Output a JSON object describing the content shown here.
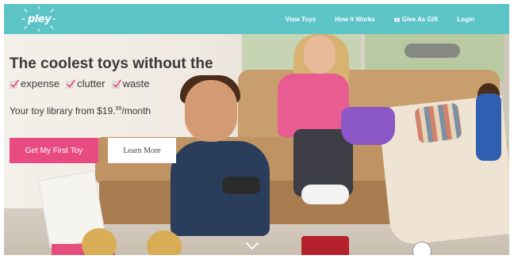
{
  "brand": {
    "logo_text": "pley"
  },
  "nav": {
    "items": [
      {
        "label": "View Toys"
      },
      {
        "label": "How it Works"
      },
      {
        "label": "Give As Gift",
        "icon": "gift-icon"
      },
      {
        "label": "Login"
      }
    ]
  },
  "hero": {
    "headline": "The coolest toys without the",
    "features": [
      "expense",
      "clutter",
      "waste"
    ],
    "subline_prefix": "Your toy library from $19.",
    "subline_cents": "99",
    "subline_suffix": "/month",
    "primary_button": "Get My First Toy",
    "secondary_button": "Learn More"
  },
  "colors": {
    "nav_background": "#5cc4c7",
    "primary_button": "#e84b82",
    "check_accent": "#e84b82",
    "headline_text": "#3a3a3a"
  },
  "icons": {
    "check": "check-icon",
    "scroll": "chevron-down-icon"
  }
}
